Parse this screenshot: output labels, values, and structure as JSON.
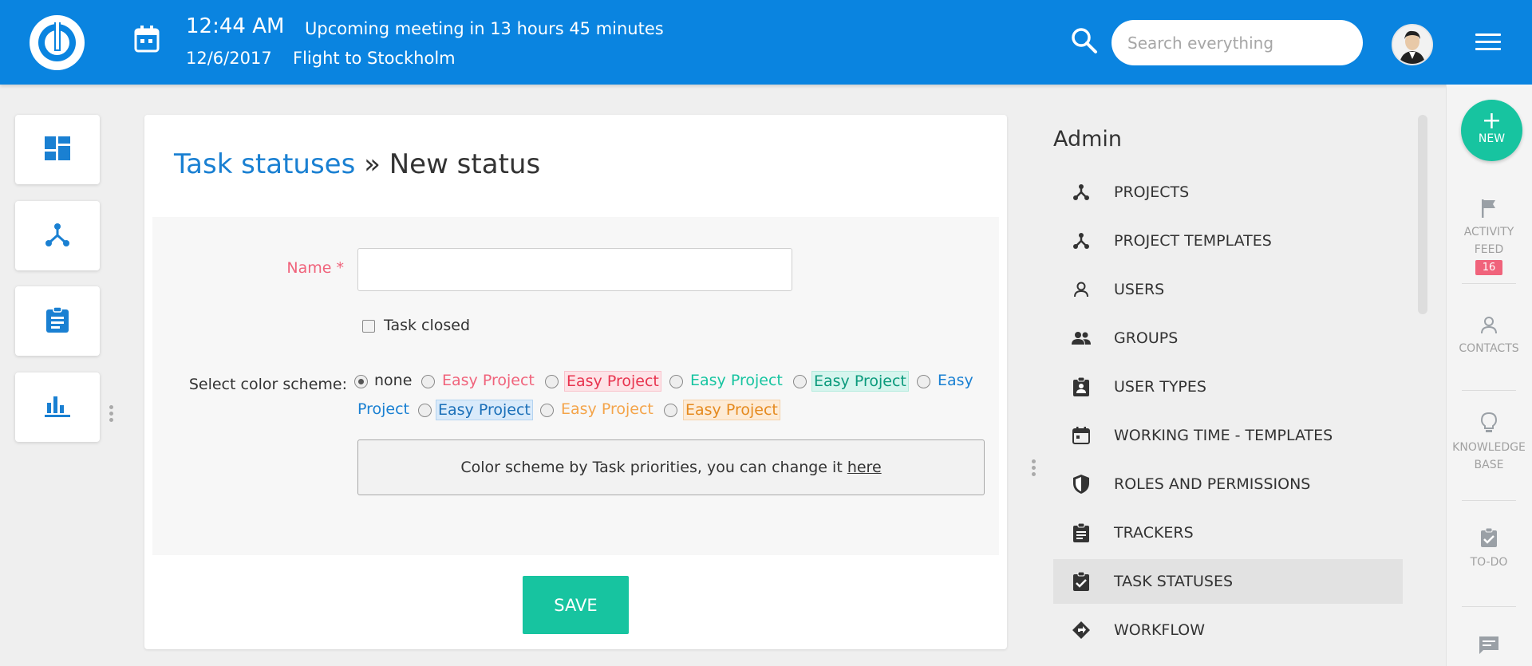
{
  "topbar": {
    "time": "12:44 AM",
    "meeting": "Upcoming meeting in 13 hours 45 minutes",
    "date": "12/6/2017",
    "event": "Flight to Stockholm",
    "search_placeholder": "Search everything"
  },
  "left_tiles": [
    "dashboard-icon",
    "projects-icon",
    "tasks-icon",
    "reports-icon"
  ],
  "page": {
    "breadcrumb": "Task statuses",
    "separator": " » ",
    "title": "New status",
    "name_label": "Name *",
    "name_value": "",
    "task_closed_label": "Task closed",
    "task_closed_checked": false,
    "color_scheme_label": "Select color scheme:",
    "color_options": [
      {
        "label": "none",
        "selected": true,
        "color": "#333333",
        "bg": ""
      },
      {
        "label": "Easy Project",
        "selected": false,
        "color": "#f0637b",
        "bg": ""
      },
      {
        "label": "Easy Project",
        "selected": false,
        "color": "#e8344f",
        "bg": "#fde3e7"
      },
      {
        "label": "Easy Project",
        "selected": false,
        "color": "#17c4a0",
        "bg": ""
      },
      {
        "label": "Easy Project",
        "selected": false,
        "color": "#0b9a7c",
        "bg": "#d6f5ee"
      },
      {
        "label": "Easy",
        "label2": "Project",
        "selected": false,
        "color": "#1a80d2",
        "bg": ""
      },
      {
        "label": "Easy Project",
        "selected": false,
        "color": "#1a6fb8",
        "bg": "#d9eafa"
      },
      {
        "label": "Easy Project",
        "selected": false,
        "color": "#f4a44a",
        "bg": ""
      },
      {
        "label": "Easy Project",
        "selected": false,
        "color": "#e58a1f",
        "bg": "#fdebd6"
      }
    ],
    "note_text": "Color scheme by Task priorities, you can change it ",
    "note_link": "here",
    "save_label": "SAVE"
  },
  "admin": {
    "title": "Admin",
    "items": [
      {
        "label": "PROJECTS",
        "icon": "projects-icon",
        "active": false
      },
      {
        "label": "PROJECT TEMPLATES",
        "icon": "project-templates-icon",
        "active": false
      },
      {
        "label": "USERS",
        "icon": "user-icon",
        "active": false
      },
      {
        "label": "GROUPS",
        "icon": "groups-icon",
        "active": false
      },
      {
        "label": "USER TYPES",
        "icon": "user-types-icon",
        "active": false
      },
      {
        "label": "WORKING TIME - TEMPLATES",
        "icon": "calendar-icon",
        "active": false
      },
      {
        "label": "ROLES AND PERMISSIONS",
        "icon": "shield-icon",
        "active": false
      },
      {
        "label": "TRACKERS",
        "icon": "clipboard-icon",
        "active": false
      },
      {
        "label": "TASK STATUSES",
        "icon": "clipboard-check-icon",
        "active": true
      },
      {
        "label": "WORKFLOW",
        "icon": "workflow-icon",
        "active": false
      }
    ]
  },
  "rightbar": {
    "new_label": "NEW",
    "activity_line1": "ACTIVITY",
    "activity_line2": "FEED",
    "activity_badge": "16",
    "contacts": "CONTACTS",
    "kb_line1": "KNOWLEDGE",
    "kb_line2": "BASE",
    "todo": "TO-DO"
  },
  "colors": {
    "brand": "#0a84e0",
    "accent": "#17c4a0",
    "required": "#f0637b",
    "link": "#1a80d2"
  }
}
